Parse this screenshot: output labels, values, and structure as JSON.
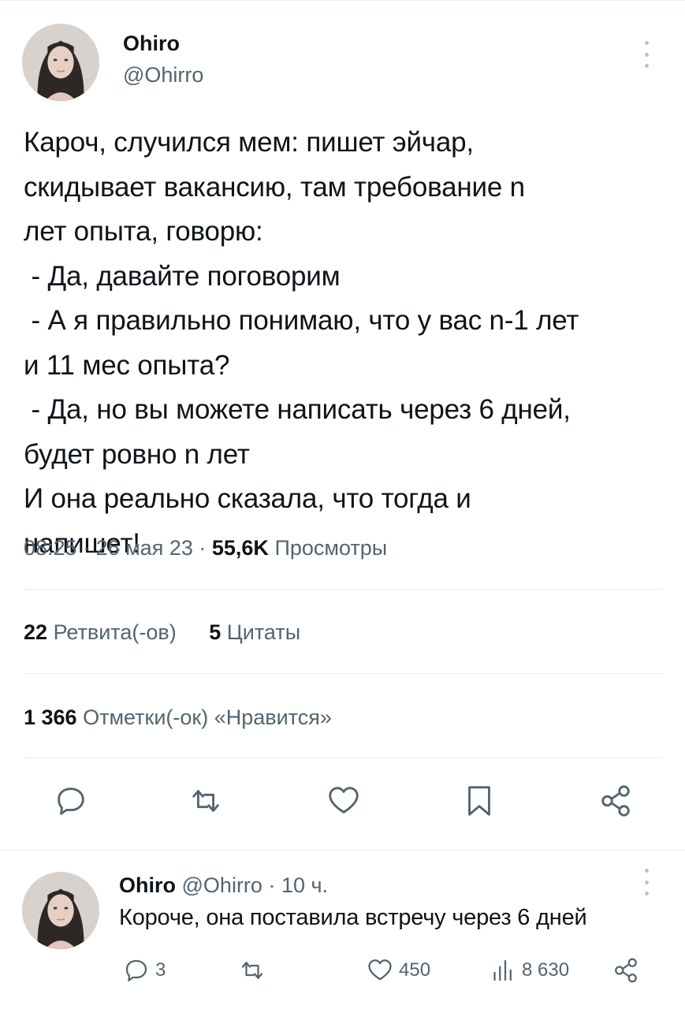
{
  "tweet": {
    "author": {
      "name": "Ohiro",
      "handle": "@Ohirro"
    },
    "text": "Кароч, случился мем: пишет эйчар,\nскидывает вакансию, там требование n\nлет опыта, говорю:\n - Да, давайте поговорим\n - А я правильно понимаю, что у вас n-1 лет\nи 11 мес опыта?\n - Да, но вы можете написать через 6 дней,\nбудет ровно n лет\nИ она реально сказала, что тогда и\nнапишет!",
    "time": "08:25",
    "date": "26 мая 23",
    "views_count": "55,6K",
    "views_label": "Просмотры",
    "retweets_count": "22",
    "retweets_label": "Ретвита(-ов)",
    "quotes_count": "5",
    "quotes_label": "Цитаты",
    "likes_count": "1 366",
    "likes_label": "Отметки(-ок) «Нравится»"
  },
  "actions": [
    {
      "name": "reply-button",
      "icon": "comment-icon"
    },
    {
      "name": "retweet-button",
      "icon": "retweet-icon"
    },
    {
      "name": "like-button",
      "icon": "heart-icon"
    },
    {
      "name": "bookmark-button",
      "icon": "bookmark-icon"
    },
    {
      "name": "share-button",
      "icon": "share-icon"
    }
  ],
  "reply": {
    "author": {
      "name": "Ohiro",
      "handle": "@Ohirro"
    },
    "time_ago": "10 ч.",
    "text": "Короче, она поставила встречу через 6 дней",
    "replies": "3",
    "retweets": "",
    "likes": "450",
    "views": "8 630"
  },
  "colors": {
    "text": "#0f1419",
    "secondary": "#536471",
    "divider": "#e6ecf0"
  }
}
